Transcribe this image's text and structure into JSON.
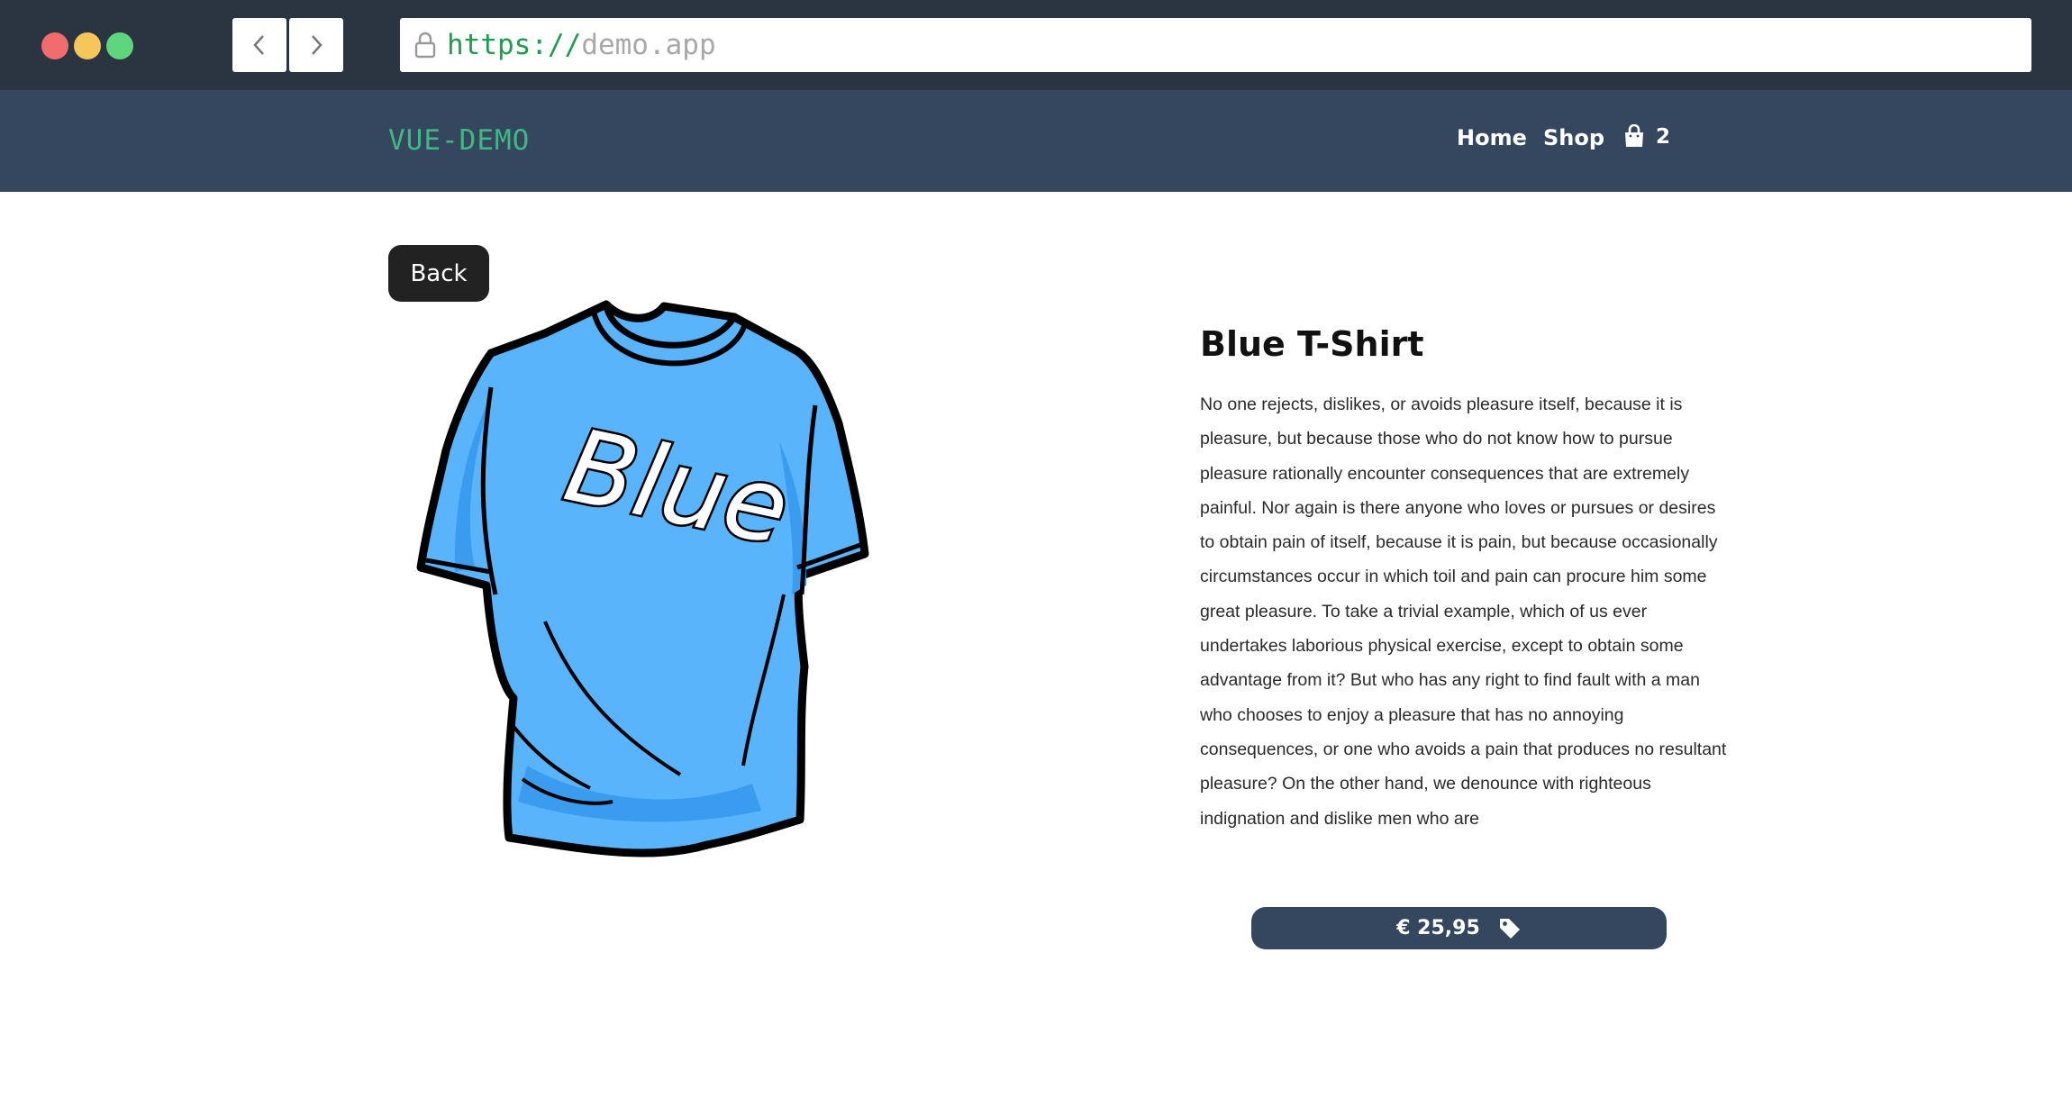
{
  "browser": {
    "url_scheme": "https://",
    "url_host": "demo.app",
    "icons": {
      "back": "chevron-left-icon",
      "forward": "chevron-right-icon",
      "lock": "lock-icon"
    }
  },
  "header": {
    "logo": "VUE-DEMO",
    "nav": {
      "home": "Home",
      "shop": "Shop"
    },
    "cart_count": "2",
    "colors": {
      "background": "#34475e",
      "logo": "#41b883"
    }
  },
  "product": {
    "back_label": "Back",
    "title": "Blue T-Shirt",
    "description": "No one rejects, dislikes, or avoids pleasure itself, because it is pleasure, but because those who do not know how to pursue pleasure rationally encounter consequences that are extremely painful. Nor again is there anyone who loves or pursues or desires to obtain pain of itself, because it is pain, but because occasionally circumstances occur in which toil and pain can procure him some great pleasure. To take a trivial example, which of us ever undertakes laborious physical exercise, except to obtain some advantage from it? But who has any right to find fault with a man who chooses to enjoy a pleasure that has no annoying consequences, or one who avoids a pain that produces no resultant pleasure? On the other hand, we denounce with righteous indignation and dislike men who are",
    "price": "€ 25,95",
    "shirt_text": "Blue",
    "shirt_color": "#5ab4fb"
  }
}
